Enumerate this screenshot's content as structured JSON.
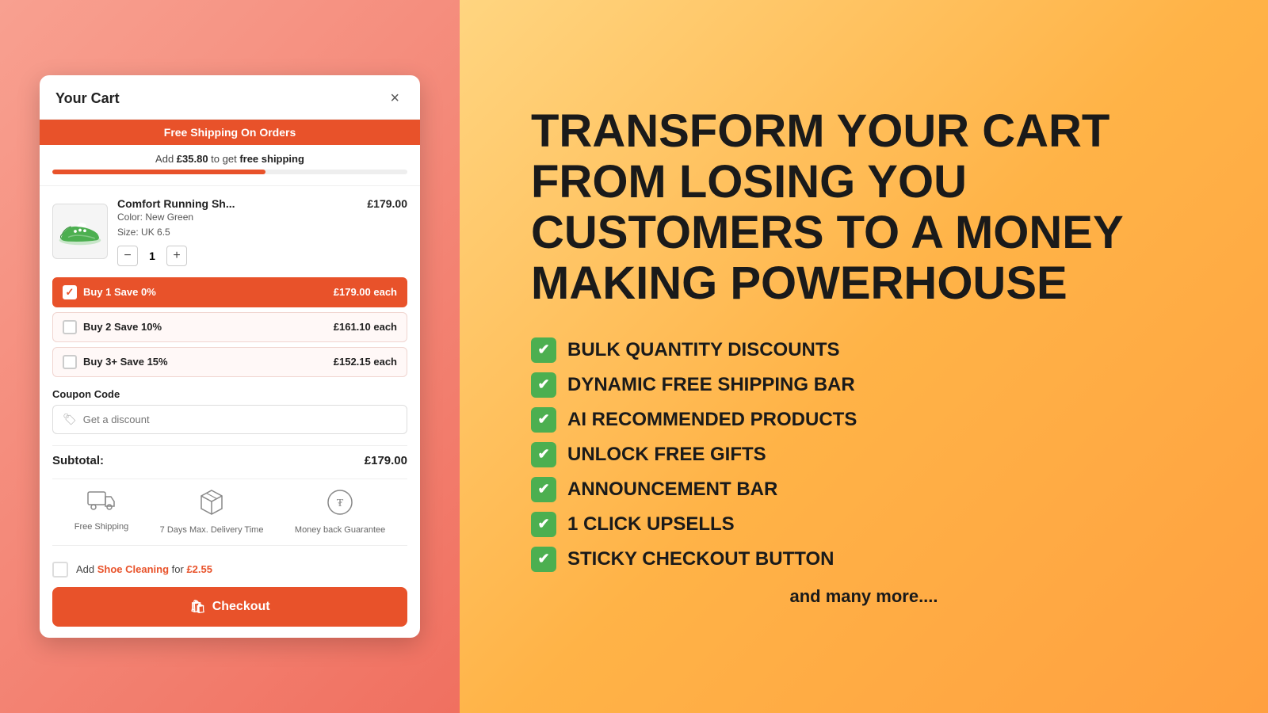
{
  "cart": {
    "title": "Your Cart",
    "close_label": "×",
    "banner": "Free Shipping On Orders",
    "shipping_progress": {
      "text_prefix": "Add ",
      "amount": "£35.80",
      "text_suffix": " to get ",
      "free_label": "free shipping",
      "progress_percent": 60
    },
    "product": {
      "name": "Comfort Running Sh...",
      "price": "£179.00",
      "color_label": "Color:",
      "color_value": "New Green",
      "size_label": "Size:",
      "size_value": "UK 6.5",
      "quantity": 1
    },
    "bulk_options": [
      {
        "label": "Buy 1 Save 0%",
        "price": "£179.00 each",
        "selected": true
      },
      {
        "label": "Buy 2 Save 10%",
        "price": "£161.10 each",
        "selected": false
      },
      {
        "label": "Buy 3+ Save 15%",
        "price": "£152.15 each",
        "selected": false
      }
    ],
    "coupon": {
      "label": "Coupon Code",
      "placeholder": "Get a discount"
    },
    "subtotal": {
      "label": "Subtotal:",
      "value": "£179.00"
    },
    "trust_badges": [
      {
        "label": "Free Shipping"
      },
      {
        "label": "7 Days Max. Delivery Time"
      },
      {
        "label": "Money back Guarantee"
      }
    ],
    "addon": {
      "prefix": "Add ",
      "product": "Shoe Cleaning",
      "middle": " for ",
      "price": "£2.55"
    },
    "checkout_label": "Checkout"
  },
  "promo": {
    "headline": "TRANSFORM YOUR CART FROM LOSING YOU CUSTOMERS TO A MONEY MAKING POWERHOUSE",
    "features": [
      "BULK QUANTITY DISCOUNTS",
      "DYNAMIC FREE SHIPPING BAR",
      "AI RECOMMENDED PRODUCTS",
      "UNLOCK FREE GIFTS",
      "ANNOUNCEMENT BAR",
      "1 CLICK UPSELLS",
      "STICKY CHECKOUT BUTTON"
    ],
    "and_more": "and many more...."
  }
}
